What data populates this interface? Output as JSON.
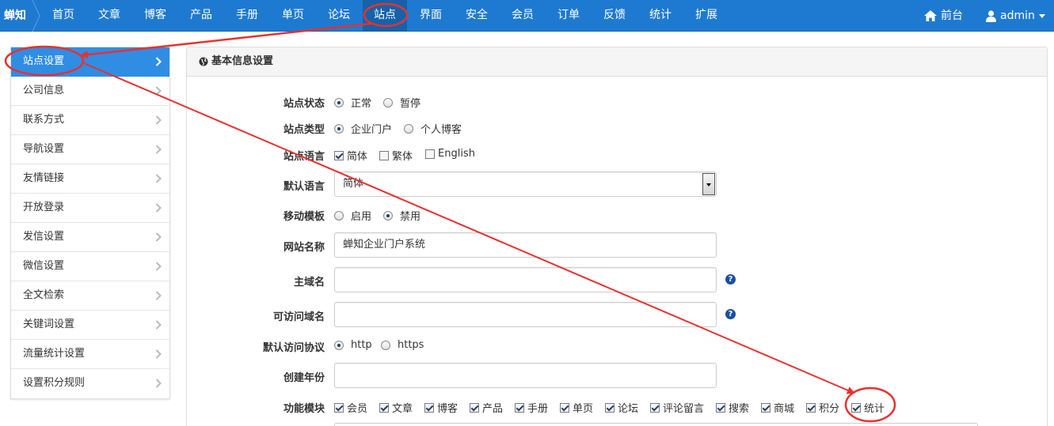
{
  "brand": "蝉知",
  "nav": {
    "items": [
      "首页",
      "文章",
      "博客",
      "产品",
      "手册",
      "单页",
      "论坛",
      "站点",
      "界面",
      "安全",
      "会员",
      "订单",
      "反馈",
      "统计",
      "扩展"
    ],
    "active": "站点",
    "frontend": "前台",
    "user": "admin"
  },
  "sidebar": {
    "items": [
      "站点设置",
      "公司信息",
      "联系方式",
      "导航设置",
      "友情链接",
      "开放登录",
      "发信设置",
      "微信设置",
      "全文检索",
      "关键词设置",
      "流量统计设置",
      "设置积分规则"
    ],
    "active": "站点设置"
  },
  "panel": {
    "title": "基本信息设置"
  },
  "form": {
    "status": {
      "label": "站点状态",
      "options": [
        "正常",
        "暂停"
      ],
      "selected": "正常"
    },
    "type": {
      "label": "站点类型",
      "options": [
        "企业门户",
        "个人博客"
      ],
      "selected": "企业门户"
    },
    "lang": {
      "label": "站点语言",
      "options": [
        "简体",
        "繁体",
        "English"
      ],
      "checked": [
        "简体"
      ]
    },
    "default_lang": {
      "label": "默认语言",
      "value": "简体"
    },
    "mobile": {
      "label": "移动模板",
      "options": [
        "启用",
        "禁用"
      ],
      "selected": "禁用"
    },
    "site_name": {
      "label": "网站名称",
      "value": "蝉知企业门户系统"
    },
    "domain": {
      "label": "主域名",
      "value": ""
    },
    "allowed_domains": {
      "label": "可访问域名",
      "value": ""
    },
    "protocol": {
      "label": "默认访问协议",
      "options": [
        "http",
        "https"
      ],
      "selected": "http"
    },
    "year": {
      "label": "创建年份",
      "value": ""
    },
    "modules": {
      "label": "功能模块",
      "options": [
        "会员",
        "文章",
        "博客",
        "产品",
        "手册",
        "单页",
        "论坛",
        "评论留言",
        "搜索",
        "商城",
        "积分",
        "统计"
      ],
      "checked": [
        "会员",
        "文章",
        "博客",
        "产品",
        "手册",
        "单页",
        "论坛",
        "评论留言",
        "搜索",
        "商城",
        "积分",
        "统计"
      ]
    },
    "help_icon": "question-circle-icon"
  },
  "colors": {
    "nav_bg": "#1e7ad0",
    "nav_active": "#1662aa",
    "sidebar_active": "#2f8de4",
    "annotation": "#e8312f"
  }
}
